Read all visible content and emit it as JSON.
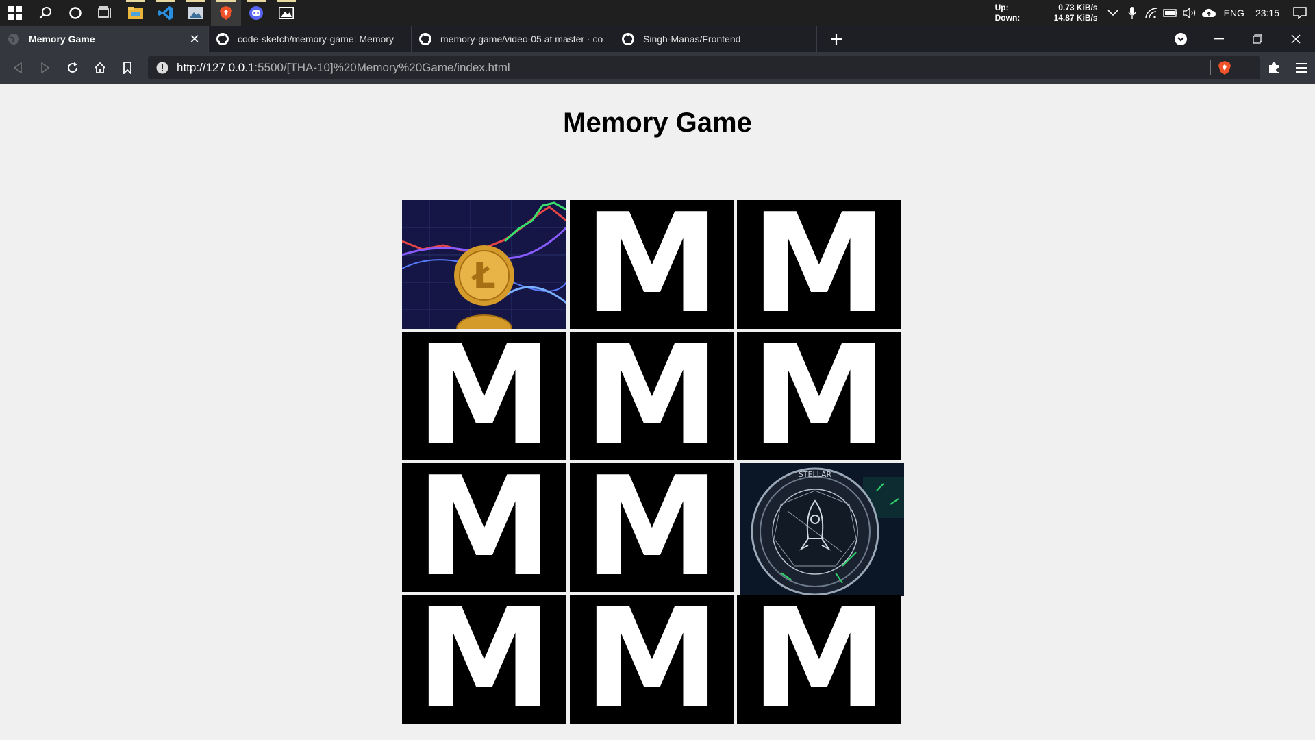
{
  "taskbar": {
    "net_up_label": "Up:",
    "net_up_value": "0.73 KiB/s",
    "net_down_label": "Down:",
    "net_down_value": "14.87 KiB/s",
    "language": "ENG",
    "clock": "23:15"
  },
  "browser": {
    "tabs": [
      {
        "label": "Memory Game"
      },
      {
        "label": "code-sketch/memory-game: Memory"
      },
      {
        "label": "memory-game/video-05 at master · co"
      },
      {
        "label": "Singh-Manas/Frontend"
      }
    ],
    "url_host": "http://127.0.0.1",
    "url_rest": ":5500/[THA-10]%20Memory%20Game/index.html"
  },
  "page": {
    "title": "Memory Game",
    "card_back_letter": "M",
    "cards": [
      {
        "state": "revealed",
        "image": "litecoin"
      },
      {
        "state": "hidden"
      },
      {
        "state": "hidden"
      },
      {
        "state": "hidden"
      },
      {
        "state": "hidden"
      },
      {
        "state": "hidden"
      },
      {
        "state": "hidden"
      },
      {
        "state": "hidden"
      },
      {
        "state": "revealed",
        "image": "stellar"
      },
      {
        "state": "hidden"
      },
      {
        "state": "hidden"
      },
      {
        "state": "hidden"
      }
    ]
  }
}
